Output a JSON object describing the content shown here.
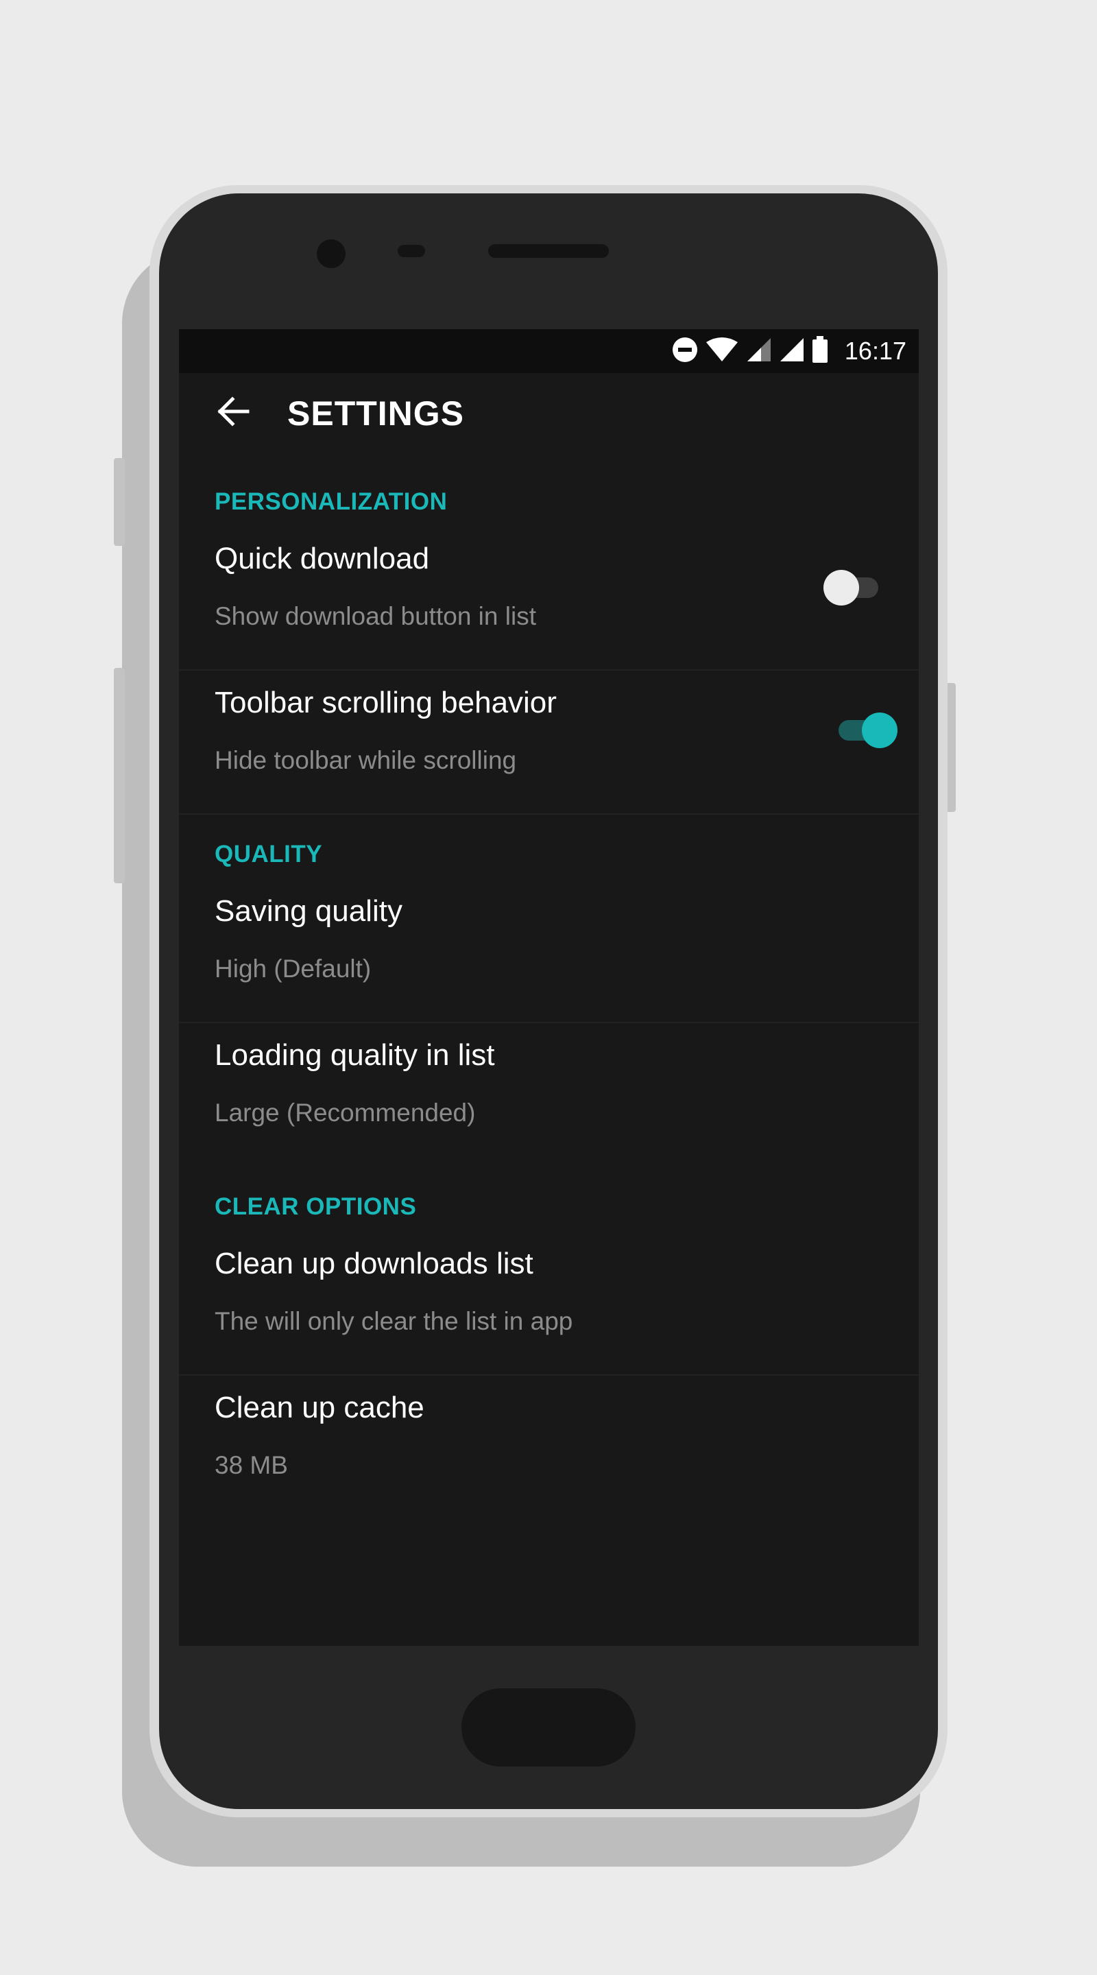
{
  "status_bar": {
    "time": "16:17",
    "icons": [
      "do-not-disturb-icon",
      "wifi-icon",
      "signal-icon",
      "signal-icon",
      "battery-icon"
    ]
  },
  "app_bar": {
    "back_icon": "arrow-back-icon",
    "title": "SETTINGS"
  },
  "accent_color": "#1ab8b8",
  "sections": [
    {
      "header": "PERSONALIZATION",
      "items": [
        {
          "title": "Quick download",
          "summary": "Show download button in list",
          "switch_on": false
        },
        {
          "title": "Toolbar scrolling behavior",
          "summary": "Hide toolbar while scrolling",
          "switch_on": true
        }
      ]
    },
    {
      "header": "QUALITY",
      "items": [
        {
          "title": "Saving quality",
          "summary": "High (Default)"
        },
        {
          "title": "Loading quality in list",
          "summary": "Large (Recommended)"
        }
      ]
    },
    {
      "header": "CLEAR OPTIONS",
      "items": [
        {
          "title": "Clean up downloads list",
          "summary": "The will only clear the list in app"
        },
        {
          "title": "Clean up cache",
          "summary": "38 MB"
        }
      ]
    }
  ]
}
